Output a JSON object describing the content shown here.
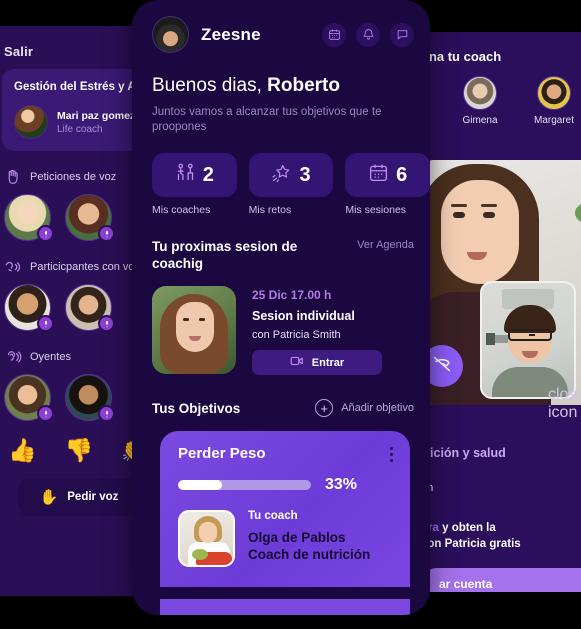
{
  "left_panel": {
    "exit_label": "Salir",
    "topic": {
      "title": "Gestión del Estrés y Ap manejar el estrés emo emocionalmente",
      "coach_name": "Mari paz gomez",
      "coach_role": "Life coach"
    },
    "sections": [
      {
        "icon": "raised-hand-icon",
        "label": "Peticiones de voz"
      },
      {
        "icon": "speaking-head-icon",
        "label": "Particicpantes con voz"
      },
      {
        "icon": "ear-listening-icon",
        "label": "Oyentes"
      }
    ],
    "reactions": [
      "👍",
      "👎",
      "👏"
    ],
    "request_voice_label": "Pedir voz",
    "request_voice_icon": "raised-hand-icon"
  },
  "center_panel": {
    "brand": "Zeesne",
    "header_icons": [
      "calendar-icon",
      "bell-icon",
      "chat-icon"
    ],
    "greeting_prefix": "Buenos dias, ",
    "greeting_name": "Roberto",
    "greeting_sub": "Juntos vamos a alcanzar tus objetivos que te proopones",
    "stats": [
      {
        "icon": "coaching-people-icon",
        "value": "2",
        "label": "Mis coaches"
      },
      {
        "icon": "shooting-star-icon",
        "value": "3",
        "label": "Mis retos"
      },
      {
        "icon": "calendar-icon",
        "value": "6",
        "label": "Mis sesiones"
      }
    ],
    "next_session": {
      "heading": "Tu proximas sesion de coachig",
      "link": "Ver Agenda",
      "date": "25 Dic  17.00 h",
      "type": "Sesion individual",
      "with": "con Patricia Smith",
      "button": "Entrar",
      "button_icon": "video-camera-icon"
    },
    "objectives": {
      "heading": "Tus Objetivos",
      "add_label": "Añadir objetivo",
      "add_icon": "plus-circle-icon",
      "goal": {
        "name": "Perder Peso",
        "progress_pct": 33,
        "progress_label": "33%",
        "coach_caption": "Tu coach",
        "coach_name": "Olga de Pablos",
        "coach_role": "Coach de nutrición",
        "menu_icon": "more-vertical-icon"
      }
    }
  },
  "right_panel": {
    "title": "ona tu coach",
    "coaches": [
      {
        "name": "Gimena"
      },
      {
        "name": "Margaret"
      }
    ],
    "hangup_icon": "phone-hangup-icon",
    "close_icon": "close-icon",
    "subtitle": "trición y salud",
    "tiny_line": "on",
    "promo_accent": "ora",
    "promo_line1": " y obten la",
    "promo_line2": " con Patricia gratis",
    "cta_label": "ar cuenta"
  },
  "colors": {
    "background": "#000000",
    "panel_deep": "#1c0840",
    "panel_left": "#2a0f56",
    "panel_right": "#2b0f5c",
    "accent_purple": "#8b5cf6",
    "goal_card": "#7c4ae0",
    "stat_box": "#331573",
    "muted_text": "#9b85c6"
  }
}
